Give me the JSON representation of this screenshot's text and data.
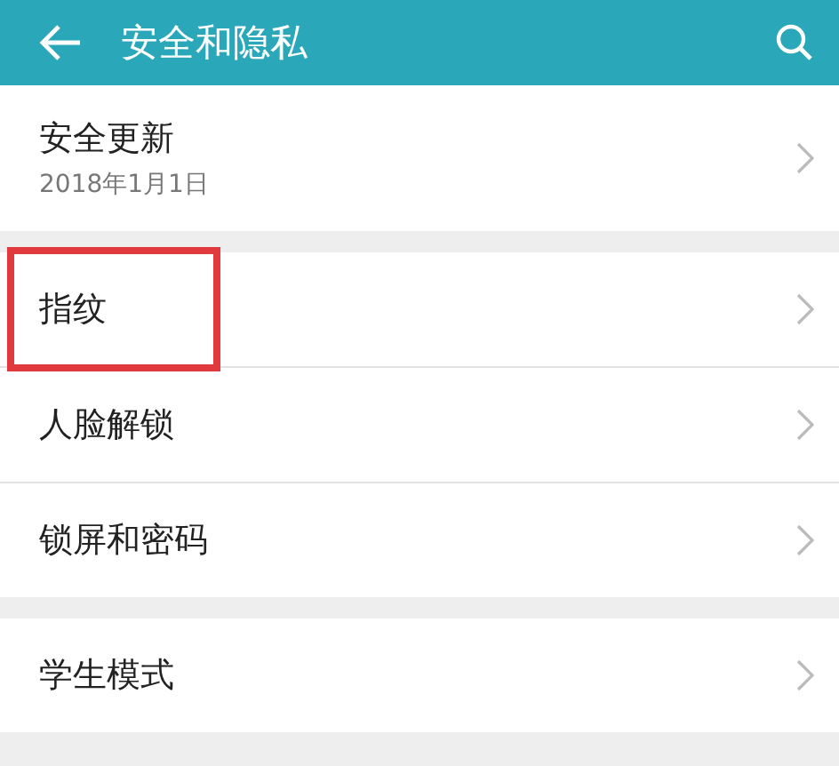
{
  "header": {
    "title": "安全和隐私"
  },
  "groups": [
    {
      "items": [
        {
          "title": "安全更新",
          "subtitle": "2018年1月1日",
          "highlighted": false
        }
      ]
    },
    {
      "items": [
        {
          "title": "指纹",
          "highlighted": true
        },
        {
          "title": "人脸解锁",
          "highlighted": false
        },
        {
          "title": "锁屏和密码",
          "highlighted": false
        }
      ]
    },
    {
      "items": [
        {
          "title": "学生模式",
          "highlighted": false
        }
      ]
    }
  ]
}
